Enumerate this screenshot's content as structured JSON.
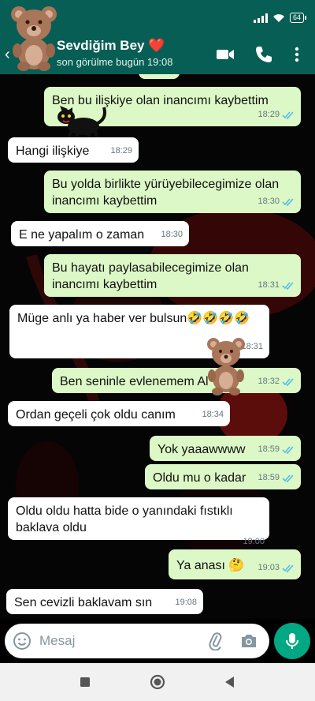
{
  "status_bar": {
    "battery": "64"
  },
  "header": {
    "contact_name": "Sevdiğim Bey ❤️",
    "contact_status": "son görülme bugün 19:08"
  },
  "messages": [
    {
      "dir": "out",
      "text": "",
      "time": "",
      "read": true
    },
    {
      "dir": "out",
      "text": "Ben bu ilişkiye olan inancımı kaybettim",
      "time": "18:29",
      "read": true
    },
    {
      "dir": "in",
      "text": "Hangi ilişkiye",
      "time": "18:29"
    },
    {
      "dir": "out",
      "text": "Bu yolda birlikte yürüyebilecegimize olan inancımı kaybettim",
      "time": "18:30",
      "read": true
    },
    {
      "dir": "in",
      "text": "E ne yapalım o zaman",
      "time": "18:30"
    },
    {
      "dir": "out",
      "text": "Bu hayatı paylasabilecegimize olan inancımı kaybettim",
      "time": "18:31",
      "read": true
    },
    {
      "dir": "in",
      "text": "Müge anlı ya haber ver bulsun🤣🤣🤣🤣",
      "time": "18:31"
    },
    {
      "dir": "out",
      "text": "Ben seninle evlenemem Al",
      "time": "18:32",
      "read": true
    },
    {
      "dir": "in",
      "text": "Ordan  geçeli çok oldu canım",
      "time": "18:34"
    },
    {
      "dir": "out",
      "text": "Yok yaaawwww",
      "time": "18:59",
      "read": true
    },
    {
      "dir": "out",
      "text": "Oldu mu o kadar",
      "time": "18:59",
      "read": true
    },
    {
      "dir": "in",
      "text": "Oldu oldu hatta bide o yanındaki fıstıklı baklava oldu",
      "time": "19:00"
    },
    {
      "dir": "out",
      "text": "Ya anası 🤔",
      "time": "19:03",
      "read": true
    },
    {
      "dir": "in",
      "text": "Sen cevizli baklavam sın",
      "time": "19:08"
    }
  ],
  "composer": {
    "placeholder": "Mesaj"
  },
  "colors": {
    "header": "#075e54",
    "outgoing_bubble": "#dcf8c6",
    "incoming_bubble": "#ffffff",
    "read_ticks": "#53bdeb",
    "mic_button": "#00a884"
  },
  "icons": [
    "back-arrow-icon",
    "teddy-bear-avatar",
    "video-call-icon",
    "phone-icon",
    "more-vert-icon",
    "black-cat-sticker",
    "teddy-bear-sticker",
    "emoji-icon",
    "attach-icon",
    "camera-icon",
    "mic-icon",
    "nav-square-icon",
    "nav-circle-icon",
    "nav-triangle-icon"
  ]
}
